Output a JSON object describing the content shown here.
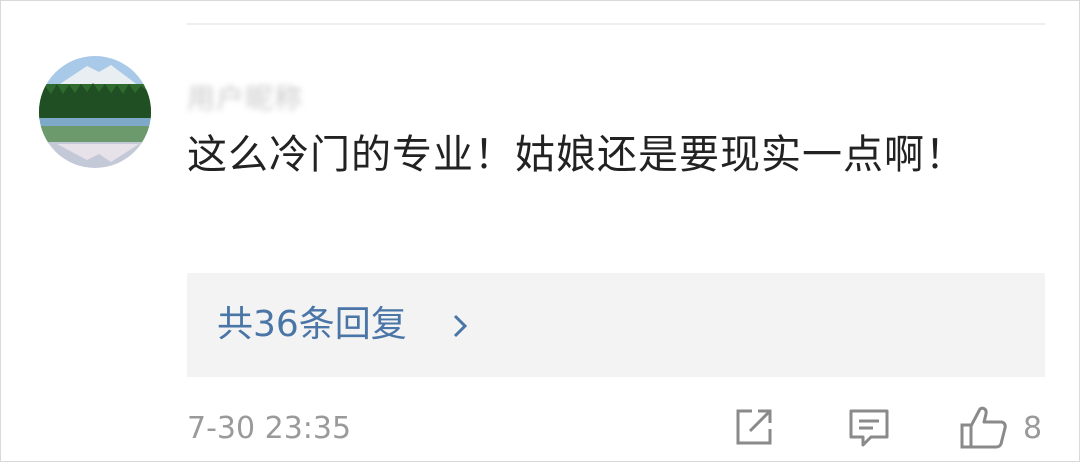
{
  "comment": {
    "username": "用户昵称",
    "text": "这么冷门的专业！姑娘还是要现实一点啊！",
    "replies_label": "共36条回复",
    "timestamp": "7-30 23:35",
    "like_count": "8"
  },
  "icons": {
    "share": "share-icon",
    "reply": "comment-icon",
    "like": "thumbs-up-icon",
    "replies_arrow": "chevron-right-icon"
  },
  "colors": {
    "link": "#4a75a7",
    "text": "#222222",
    "muted": "#9a9a9a",
    "reply_bg": "#f3f3f3"
  }
}
